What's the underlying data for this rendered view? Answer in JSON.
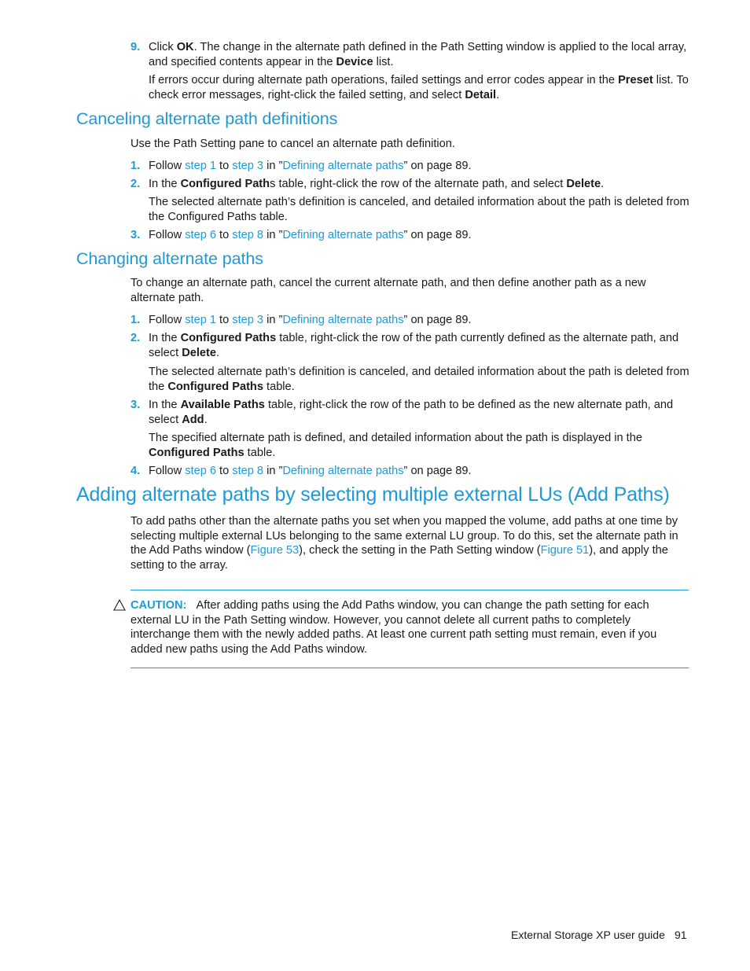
{
  "step9": {
    "number": "9.",
    "pre": "Click ",
    "ok": "OK",
    "mid": ". The change in the alternate path defined in the Path Setting window is applied to the local array, and specified contents appear in the ",
    "device": "Device",
    "post": " list.",
    "note_pre": "If errors occur during alternate path operations, failed settings and error codes appear in the ",
    "preset": "Preset",
    "note_mid": " list. To check error messages, right-click the failed setting, and select ",
    "detail": "Detail",
    "note_post": "."
  },
  "cancel_section": {
    "heading": "Canceling alternate path definitions",
    "intro": "Use the Path Setting pane to cancel an alternate path definition.",
    "step1": {
      "number": "1.",
      "follow": "Follow ",
      "link1": "step 1",
      "to": " to ",
      "link2": "step 3",
      "in": " in ”",
      "link3": "Defining alternate paths",
      "post": "” on page 89."
    },
    "step2": {
      "number": "2.",
      "pre": "In the ",
      "bold": "Configured Path",
      "mid": "s table, right-click the row of the alternate path, and select ",
      "bold2": "Delete",
      "post": ".",
      "note": "The selected alternate path’s definition is canceled, and detailed information about the path is deleted from the Configured Paths table."
    },
    "step3": {
      "number": "3.",
      "follow": "Follow ",
      "link1": "step 6",
      "to": " to ",
      "link2": "step 8",
      "in": " in ”",
      "link3": "Defining alternate paths",
      "post": "” on page 89."
    }
  },
  "change_section": {
    "heading": "Changing alternate paths",
    "intro": "To change an alternate path, cancel the current alternate path, and then define another path as a new alternate path.",
    "step1": {
      "number": "1.",
      "follow": "Follow ",
      "link1": "step 1",
      "to": " to ",
      "link2": "step 3",
      "in": " in ”",
      "link3": "Defining alternate paths",
      "post": "” on page 89."
    },
    "step2": {
      "number": "2.",
      "pre": "In the ",
      "bold": "Configured Paths",
      "mid": " table, right-click the row of the path currently defined as the alternate path, and select ",
      "bold2": "Delete",
      "post": ".",
      "note_pre": "The selected alternate path’s definition is canceled, and detailed information about the path is deleted from the ",
      "note_bold": "Configured Paths",
      "note_post": " table."
    },
    "step3": {
      "number": "3.",
      "pre": "In the ",
      "bold": "Available Paths",
      "mid": " table, right-click the row of the path to be defined as the new alternate path, and select ",
      "bold2": "Add",
      "post": ".",
      "note_pre": "The specified alternate path is defined, and detailed information about the path is displayed in the ",
      "note_bold": "Configured Paths",
      "note_post": " table."
    },
    "step4": {
      "number": "4.",
      "follow": "Follow ",
      "link1": "step 6",
      "to": " to ",
      "link2": "step 8",
      "in": " in ”",
      "link3": "Defining alternate paths",
      "post": "” on page 89."
    }
  },
  "add_section": {
    "heading": "Adding alternate paths by selecting multiple external LUs (Add Paths)",
    "intro_pre": "To add paths other than the alternate paths you set when you mapped the volume, add paths at one time by selecting multiple external LUs belonging to the same external LU group. To do this, set the alternate path in the Add Paths window (",
    "fig53": "Figure 53",
    "intro_mid": "), check the setting in the Path Setting window (",
    "fig51": "Figure 51",
    "intro_post": "), and apply the setting to the array.",
    "caution_icon": "warning-triangle-icon",
    "caution_label": "CAUTION:",
    "caution_text": "After adding paths using the Add Paths window, you can change the path setting for each external LU in the Path Setting window. However, you cannot delete all current paths to completely interchange them with the newly added paths. At least one current path setting must remain, even if you added new paths using the Add Paths window."
  },
  "footer": {
    "title": "External Storage XP user guide",
    "page": "91"
  },
  "colors": {
    "accent": "#1e9ad6",
    "text": "#1a1a1a"
  }
}
